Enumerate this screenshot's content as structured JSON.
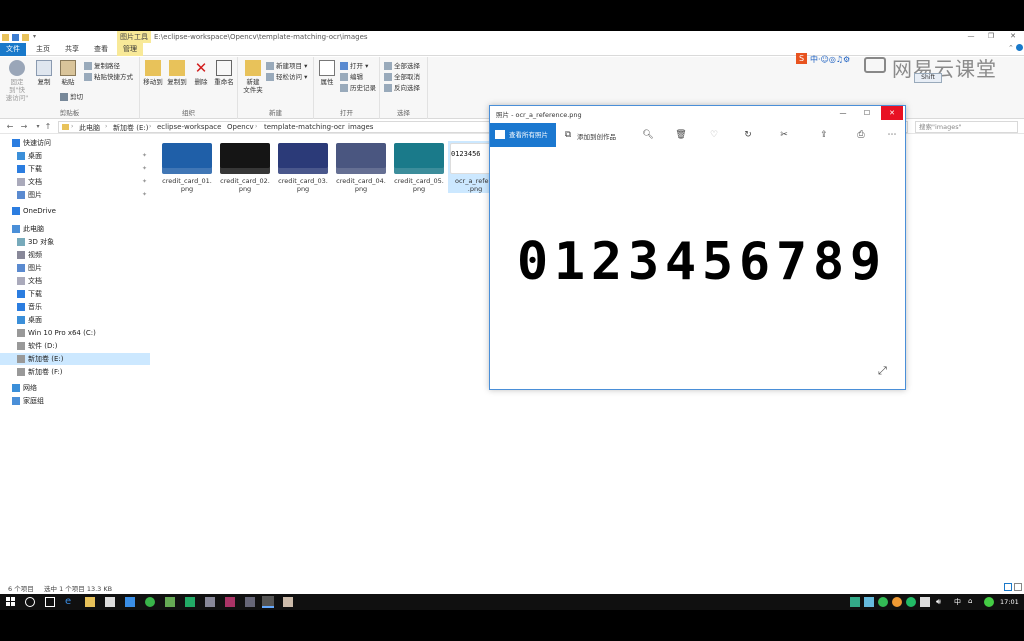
{
  "explorer": {
    "path_title": "E:\\eclipse-workspace\\Opencv\\template-matching-ocr\\images",
    "picture_tools_label": "图片工具",
    "tabs": [
      "文件",
      "主页",
      "共享",
      "查看",
      "管理"
    ],
    "ribbon": {
      "clipboard": {
        "pin_label": "固定到\"快\n速访问\"",
        "copy_label": "复制",
        "paste_label": "粘贴",
        "copy_path_label": "复制路径",
        "paste_shortcut_label": "粘贴快捷方式",
        "cut_label": "剪切",
        "group_label": "剪贴板"
      },
      "organize": {
        "move_to_label": "移动到",
        "copy_to_label": "复制到",
        "delete_label": "删除",
        "rename_label": "重命名",
        "group_label": "组织"
      },
      "new": {
        "new_folder_label": "新建\n文件夹",
        "new_item_label": "新建项目",
        "easy_access_label": "轻松访问",
        "group_label": "新建"
      },
      "open": {
        "properties_label": "属性",
        "open_label": "打开",
        "edit_label": "编辑",
        "history_label": "历史记录",
        "group_label": "打开"
      },
      "select": {
        "select_all_label": "全部选择",
        "select_none_label": "全部取消",
        "invert_label": "反向选择",
        "group_label": "选择"
      }
    },
    "breadcrumb": [
      "此电脑",
      "新加卷 (E:)",
      "eclipse-workspace",
      "Opencv",
      "template-matching-ocr",
      "images"
    ],
    "search_placeholder": "搜索\"images\"",
    "nav": [
      {
        "label": "快速访问",
        "icon": "star-icon",
        "level": 0
      },
      {
        "label": "桌面",
        "icon": "desktop-icon",
        "level": 1,
        "pinned": true
      },
      {
        "label": "下载",
        "icon": "download-icon",
        "level": 1,
        "pinned": true
      },
      {
        "label": "文档",
        "icon": "document-icon",
        "level": 1,
        "pinned": true
      },
      {
        "label": "图片",
        "icon": "picture-icon",
        "level": 1,
        "pinned": true
      },
      {
        "label": "OneDrive",
        "icon": "cloud-icon",
        "level": 0
      },
      {
        "label": "此电脑",
        "icon": "computer-icon",
        "level": 0
      },
      {
        "label": "3D 对象",
        "icon": "cube-icon",
        "level": 1
      },
      {
        "label": "视频",
        "icon": "video-icon",
        "level": 1
      },
      {
        "label": "图片",
        "icon": "picture-icon",
        "level": 1
      },
      {
        "label": "文档",
        "icon": "document-icon",
        "level": 1
      },
      {
        "label": "下载",
        "icon": "download-icon",
        "level": 1
      },
      {
        "label": "音乐",
        "icon": "music-icon",
        "level": 1
      },
      {
        "label": "桌面",
        "icon": "desktop-icon",
        "level": 1
      },
      {
        "label": "Win 10 Pro x64 (C:)",
        "icon": "drive-icon",
        "level": 1
      },
      {
        "label": "软件 (D:)",
        "icon": "drive-icon",
        "level": 1
      },
      {
        "label": "新加卷 (E:)",
        "icon": "drive-icon",
        "level": 1,
        "selected": true
      },
      {
        "label": "新加卷 (F:)",
        "icon": "drive-icon",
        "level": 1
      },
      {
        "label": "网络",
        "icon": "network-icon",
        "level": 0
      },
      {
        "label": "家庭组",
        "icon": "homegroup-icon",
        "level": 0
      }
    ],
    "files": [
      {
        "name": "credit_card_01.\npng",
        "thumb": "#1f5fa8"
      },
      {
        "name": "credit_card_02.\npng",
        "thumb": "#151515"
      },
      {
        "name": "credit_card_03.\npng",
        "thumb": "#2b3a78"
      },
      {
        "name": "credit_card_04.\npng",
        "thumb": "#4a5680"
      },
      {
        "name": "credit_card_05.\npng",
        "thumb": "#1a7a8a"
      },
      {
        "name": "ocr_a_refere\n.png",
        "thumb": "#ffffff",
        "thumb_text": "0123456",
        "selected": true
      }
    ],
    "status": {
      "count": "6 个项目",
      "selection": "选中 1 个项目  13.3 KB"
    }
  },
  "viewer": {
    "title": "照片 - ocr_a_reference.png",
    "all_photos_label": "查看所有照片",
    "add_creation_label": "添加到创作品",
    "toolbar_icons": [
      "zoom-icon",
      "delete-icon",
      "heart-icon",
      "rotate-icon",
      "edit-icon",
      "share-icon",
      "print-icon",
      "more-icon"
    ],
    "digits": "0123456789"
  },
  "watermark": {
    "text": "网易云课堂",
    "shift_chip": "Shift"
  },
  "taskbar": {
    "time": "17:01"
  },
  "colors": {
    "accent": "#1979ca",
    "close_red": "#e81123",
    "selection": "#cce8ff",
    "tools_yellow": "#f8e998"
  }
}
